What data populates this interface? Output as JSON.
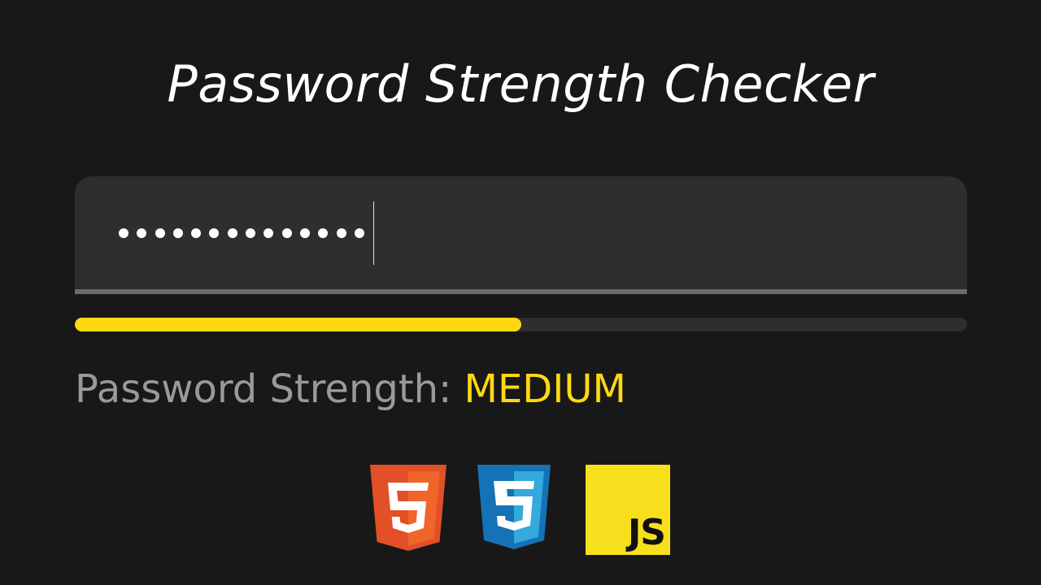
{
  "title": "Password Strength Checker",
  "password_field": {
    "masked_length": 14
  },
  "strength_meter": {
    "fraction": 0.5,
    "fill_color": "#ffd90f",
    "track_color": "#2e2e2e"
  },
  "strength": {
    "label": "Password Strength:",
    "value": "MEDIUM",
    "value_color": "#ffd90f"
  },
  "tech_logos": [
    {
      "icon": "html5-icon"
    },
    {
      "icon": "css3-icon"
    },
    {
      "icon": "javascript-icon",
      "text": "JS"
    }
  ]
}
